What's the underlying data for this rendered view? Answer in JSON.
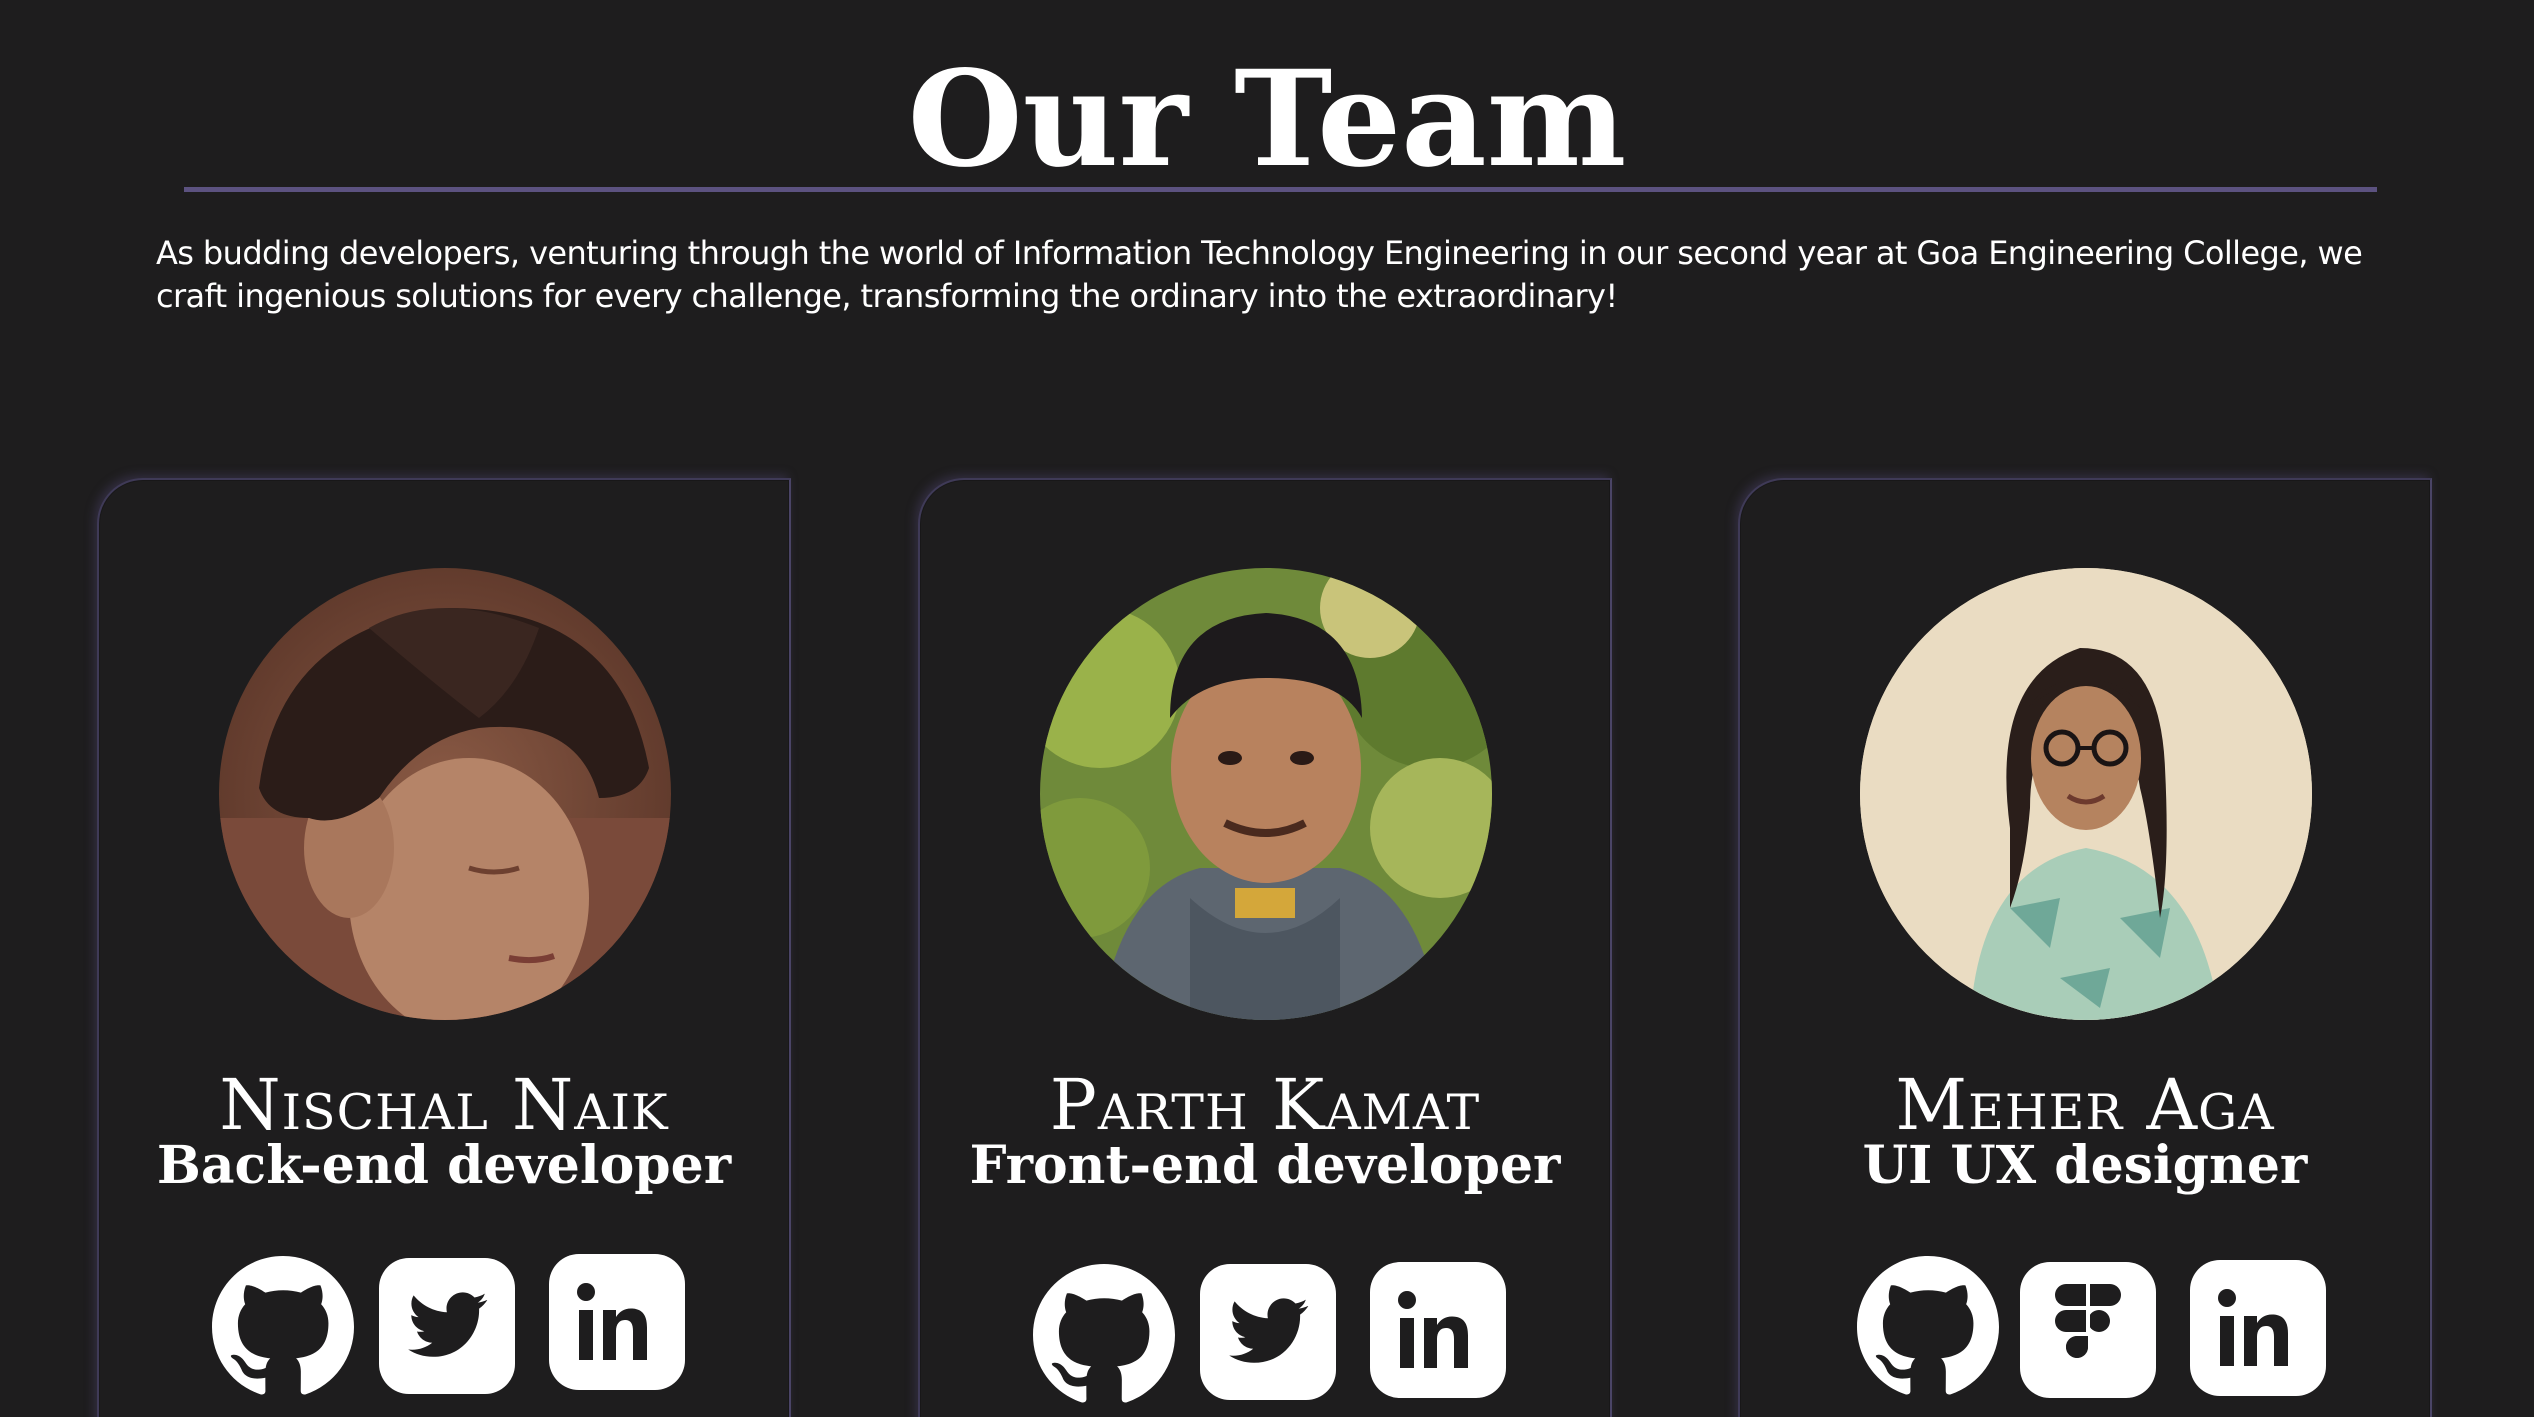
{
  "header": {
    "title": "Our Team",
    "intro": "As budding developers, venturing through the world of Information Technology Engineering in our second year at Goa Engineering College, we craft ingenious solutions for every challenge, transforming the ordinary into the extraordinary!"
  },
  "colors": {
    "background": "#1e1d1e",
    "accent_rule": "#5c5280",
    "card_border": "#3f3a57",
    "text": "#ffffff"
  },
  "members": [
    {
      "name": "Nischal Naik",
      "role": "Back-end developer",
      "photo": "portrait-photo",
      "socials": [
        "github-icon",
        "twitter-icon",
        "linkedin-icon"
      ]
    },
    {
      "name": "Parth Kamat",
      "role": "Front-end developer",
      "photo": "portrait-photo",
      "socials": [
        "github-icon",
        "twitter-icon",
        "linkedin-icon"
      ]
    },
    {
      "name": "Meher Aga",
      "role": "UI UX designer",
      "photo": "portrait-photo",
      "socials": [
        "github-icon",
        "figma-icon",
        "linkedin-icon"
      ]
    }
  ]
}
